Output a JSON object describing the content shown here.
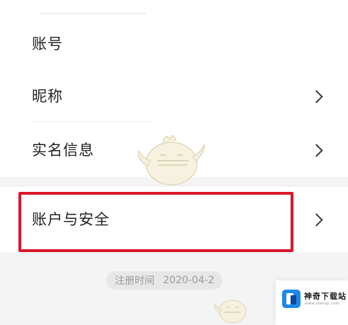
{
  "settings": {
    "items": [
      {
        "label": "账号",
        "has_chevron": false
      },
      {
        "label": "昵称",
        "has_chevron": true
      },
      {
        "label": "实名信息",
        "has_chevron": true
      },
      {
        "label": "账户与安全",
        "has_chevron": true,
        "highlighted": true
      }
    ],
    "chevron_icon": "chevron-right-icon"
  },
  "registration": {
    "label": "注册时间",
    "date": "2020-04-2"
  },
  "watermark": {
    "site_name": "神奇下载站",
    "site_url": "www.shenqi.com"
  },
  "colors": {
    "highlight": "#d9172b",
    "background": "#f4f4f5",
    "brand_blue": "#1e88e5"
  }
}
